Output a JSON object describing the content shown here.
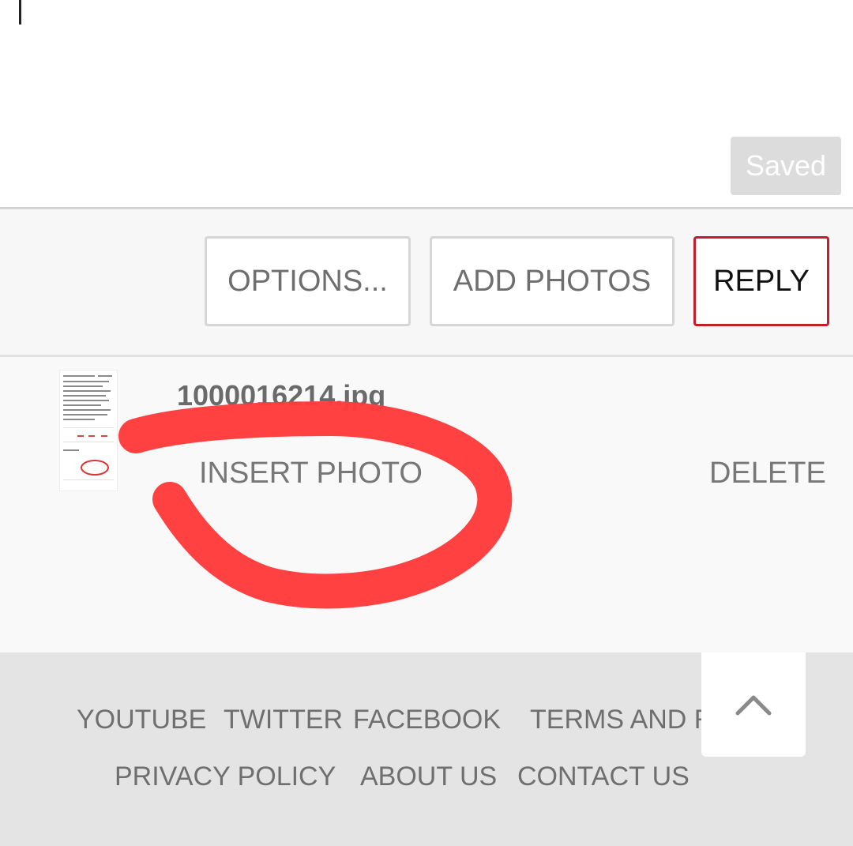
{
  "editor": {
    "saved_label": "Saved"
  },
  "toolbar": {
    "options_label": "OPTIONS...",
    "add_photos_label": "ADD PHOTOS",
    "reply_label": "REPLY"
  },
  "attachment": {
    "filename": "1000016214.jpg",
    "insert_label": "INSERT PHOTO",
    "delete_label": "DELETE",
    "annotation_color": "#ff3b3b"
  },
  "footer": {
    "links": [
      "YOUTUBE",
      "TWITTER",
      "FACEBOOK",
      "TERMS AND RU",
      "PRIVACY POLICY",
      "ABOUT US",
      "CONTACT US"
    ],
    "scroll_top_icon": "chevron-up-icon"
  },
  "colors": {
    "accent": "#c41e2c",
    "annotation": "#ff3b3b"
  }
}
